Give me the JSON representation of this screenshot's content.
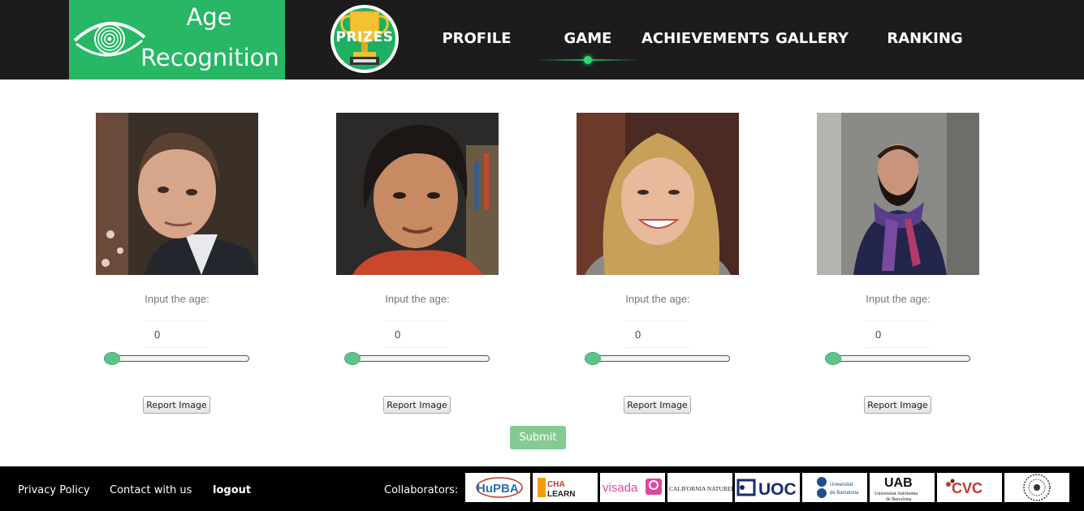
{
  "header": {
    "logo_line1": "Age",
    "logo_line2": "Recognition",
    "prizes_label": "PRIZES",
    "nav": [
      "PROFILE",
      "GAME",
      "ACHIEVEMENTS",
      "GALLERY",
      "RANKING"
    ],
    "active_nav": "GAME"
  },
  "cards": [
    {
      "input_label": "Input the age:",
      "age_value": "0",
      "slider_value": 0,
      "report_label": "Report Image"
    },
    {
      "input_label": "Input the age:",
      "age_value": "0",
      "slider_value": 0,
      "report_label": "Report Image"
    },
    {
      "input_label": "Input the age:",
      "age_value": "0",
      "slider_value": 0,
      "report_label": "Report Image"
    },
    {
      "input_label": "Input the age:",
      "age_value": "0",
      "slider_value": 0,
      "report_label": "Report Image"
    }
  ],
  "submit_label": "Submit",
  "footer": {
    "privacy": "Privacy Policy",
    "contact": "Contact with us",
    "logout": "logout",
    "collaborators_label": "Collaborators:",
    "collaborators": [
      "HuPBA",
      "CHA LEARN",
      "visada",
      "CALIFORNIA NATUREL",
      "UOC",
      "Universitat de Barcelona",
      "UAB",
      "CVC"
    ]
  },
  "colors": {
    "brand_green": "#27b765",
    "header_bg": "#1c1c1c",
    "footer_bg": "#000000",
    "submit_bg": "#86ca93",
    "slider_thumb": "#5dc38a"
  }
}
